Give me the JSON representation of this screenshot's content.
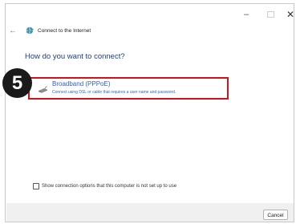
{
  "window": {
    "minimize_glyph": "–",
    "close_glyph": "✕"
  },
  "nav": {
    "back_glyph": "←",
    "title": "Connect to the Internet"
  },
  "main": {
    "heading": "How do you want to connect?",
    "option": {
      "title": "Broadband (PPPoE)",
      "description": "Connect using DSL or cable that requires a user name and password.",
      "icon": "broadband-icon"
    },
    "step_badge": "5",
    "checkbox": {
      "label": "Show connection options that this computer is not set up to use",
      "checked": false
    }
  },
  "footer": {
    "cancel_label": "Cancel"
  },
  "colors": {
    "highlight_border": "#d4101b",
    "link_blue": "#3060c0",
    "heading_blue": "#1d3f7a",
    "badge_bg": "#1a1a1a"
  }
}
